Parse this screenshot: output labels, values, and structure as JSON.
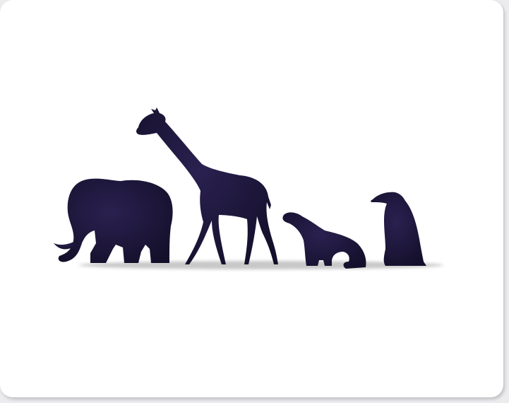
{
  "scene": {
    "subjects": [
      "elephant",
      "giraffe",
      "seal",
      "penguin"
    ],
    "colors": {
      "silhouette": "#17112e",
      "silhouette_light": "#2a2150",
      "ground_shadow": "#c8c8c8",
      "background": "#ffffff",
      "frame": "#ececef"
    }
  }
}
